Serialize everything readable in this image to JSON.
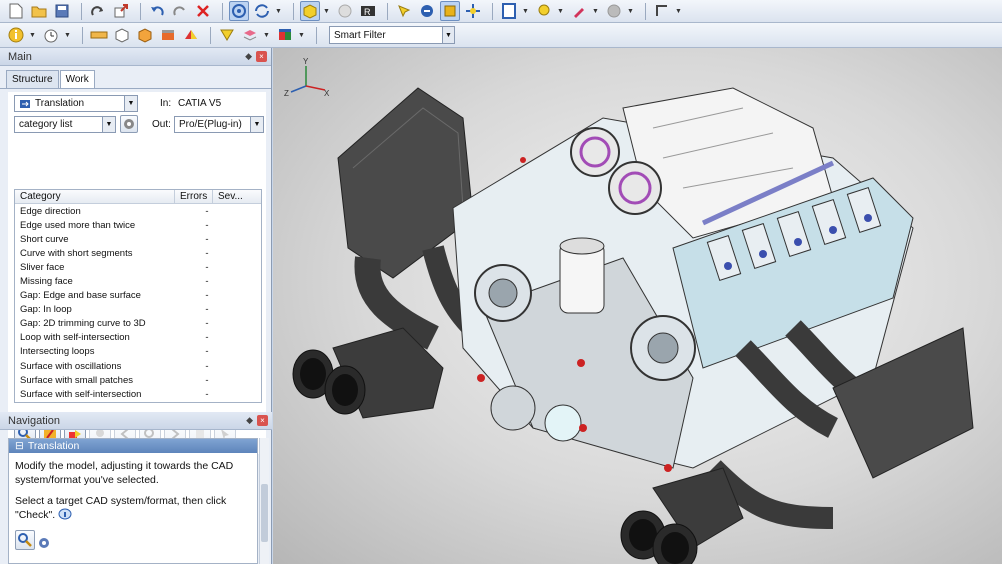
{
  "toolbar": {
    "row1_icons": [
      "new-file-icon",
      "open-folder-icon",
      "save-icon",
      "redo-icon",
      "export-icon",
      "undo-icon",
      "redo-arrow-icon",
      "delete-icon",
      "rotate-icon",
      "sync-icon",
      "shaded-box-icon",
      "half-moon-icon",
      "r-tool-icon",
      "highlight-icon",
      "swap-icon",
      "cube-select-icon",
      "move-icon",
      "page-icon",
      "pin-icon",
      "marker-icon",
      "grey-circle-icon",
      "corner-icon"
    ],
    "row2_icons": [
      "info-icon",
      "clock-icon",
      "ruler-icon",
      "box-outline-icon",
      "box-orange-icon",
      "container-icon",
      "faces-icon",
      "triangle-icon",
      "layers-icon",
      "color-cube-icon"
    ],
    "smart_filter": "Smart Filter"
  },
  "main_panel": {
    "title": "Main",
    "tabs": [
      {
        "label": "Structure",
        "active": false
      },
      {
        "label": "Work",
        "active": true
      }
    ],
    "operation": "Translation",
    "in_label": "In:",
    "in_value": "CATIA V5",
    "view_mode": "category list",
    "out_label": "Out:",
    "out_value": "Pro/E(Plug-in)",
    "table": {
      "columns": [
        "Category",
        "Errors",
        "Sev..."
      ],
      "rows": [
        {
          "category": "Edge direction",
          "errors": "-"
        },
        {
          "category": "Edge used more than twice",
          "errors": "-"
        },
        {
          "category": "Short curve",
          "errors": "-"
        },
        {
          "category": "Curve with short segments",
          "errors": "-"
        },
        {
          "category": "Sliver face",
          "errors": "-"
        },
        {
          "category": "Missing face",
          "errors": "-"
        },
        {
          "category": "Gap: Edge and base surface",
          "errors": "-"
        },
        {
          "category": "Gap: In loop",
          "errors": "-"
        },
        {
          "category": "Gap: 2D trimming curve to 3D",
          "errors": "-"
        },
        {
          "category": "Loop with self-intersection",
          "errors": "-"
        },
        {
          "category": "Intersecting loops",
          "errors": "-"
        },
        {
          "category": "Surface with oscillations",
          "errors": "-"
        },
        {
          "category": "Surface with small patches",
          "errors": "-"
        },
        {
          "category": "Surface with self-intersection",
          "errors": "-"
        }
      ]
    }
  },
  "navigation_panel": {
    "title": "Navigation",
    "section": "Translation",
    "text1": "Modify the model, adjusting it towards the CAD system/format you've selected.",
    "text2": "Select a target CAD system/format, then click \"Check\"."
  },
  "viewport": {
    "axis_labels": [
      "Y",
      "Z",
      "X"
    ]
  },
  "colors": {
    "accent": "#5e85bb",
    "toolbar_bg": "#dbe3ef",
    "engine_blue": "#c6dfe8",
    "exhaust_grey": "#4a4a4a"
  }
}
